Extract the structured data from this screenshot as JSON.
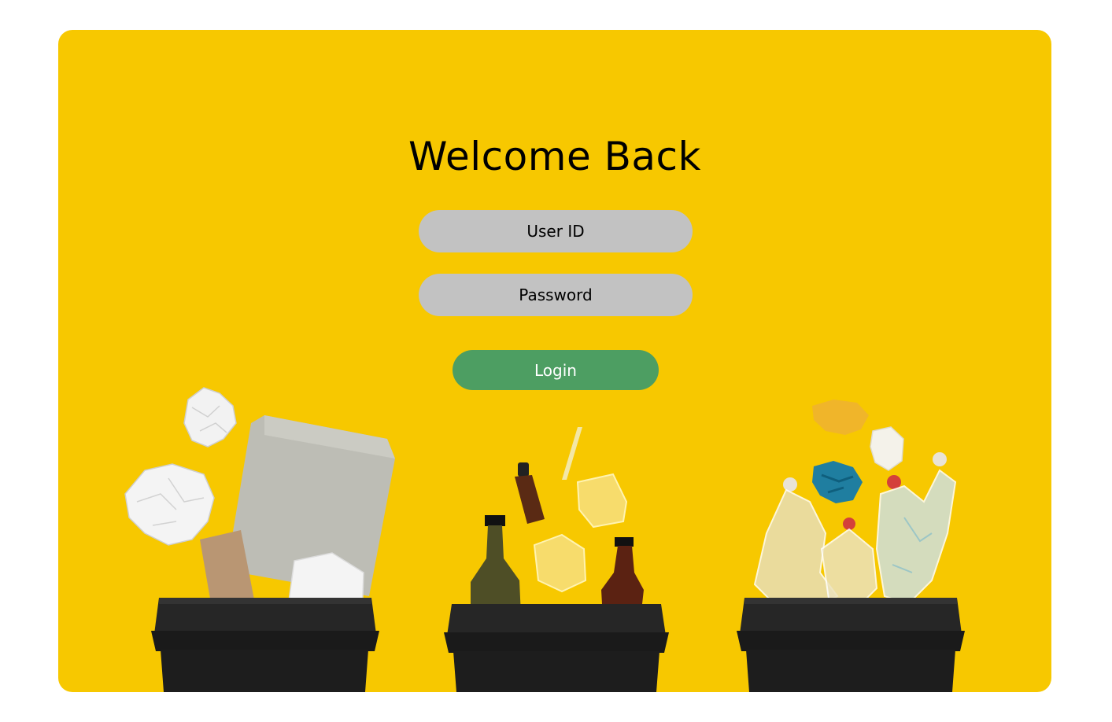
{
  "login": {
    "title": "Welcome Back",
    "user_id_placeholder": "User ID",
    "password_placeholder": "Password",
    "login_label": "Login"
  },
  "colors": {
    "background": "#f7c800",
    "field": "#c2c2c2",
    "button": "#4d9e62",
    "bin": "#1c1c1c"
  },
  "icons": {
    "paper_bin": "paper-recycling-bin-icon",
    "glass_bin": "glass-recycling-bin-icon",
    "plastic_bin": "plastic-recycling-bin-icon"
  }
}
